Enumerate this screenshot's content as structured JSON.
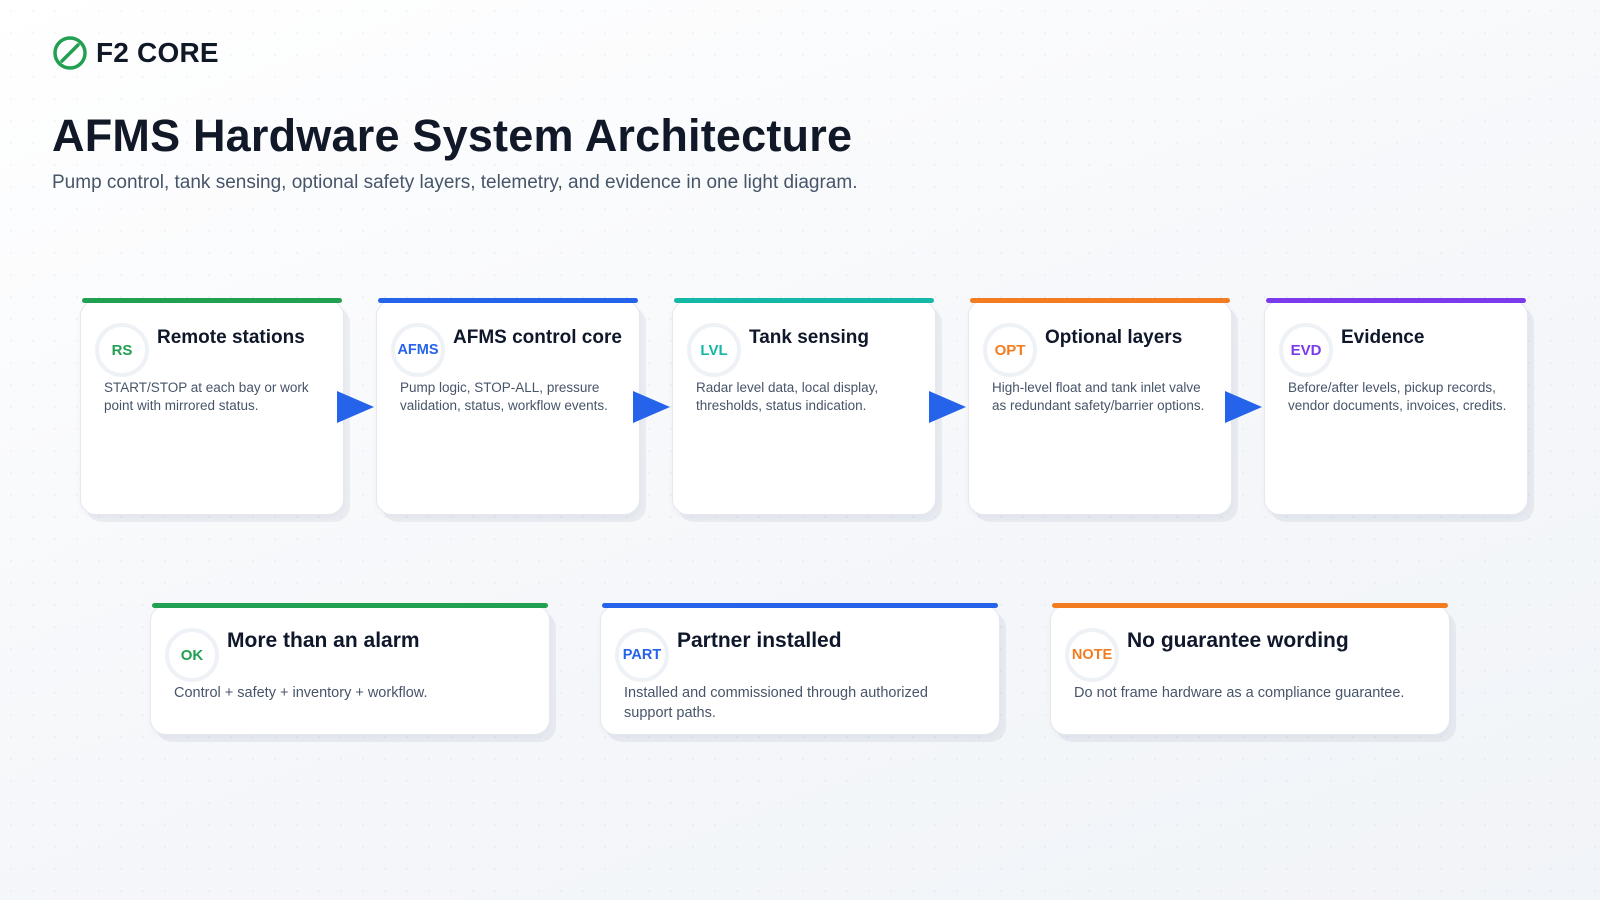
{
  "brand": {
    "name": "F2 CORE",
    "color": "#22a052"
  },
  "page": {
    "title": "AFMS Hardware System Architecture",
    "subtitle": "Pump control, tank sensing, optional safety layers, telemetry, and evidence in one light diagram."
  },
  "flow": [
    {
      "badge": "RS",
      "title": "Remote stations",
      "description": "START/STOP at each bay or work point with mirrored status.",
      "color": "#22a052"
    },
    {
      "badge": "AFMS",
      "title": "AFMS control core",
      "description": "Pump logic, STOP-ALL, pressure validation, status, workflow events.",
      "color": "#2563eb"
    },
    {
      "badge": "LVL",
      "title": "Tank sensing",
      "description": "Radar level data, local display, thresholds, status indication.",
      "color": "#14b8a6"
    },
    {
      "badge": "OPT",
      "title": "Optional layers",
      "description": "High-level float and tank inlet valve as redundant safety/barrier options.",
      "color": "#f47c20"
    },
    {
      "badge": "EVD",
      "title": "Evidence",
      "description": "Before/after levels, pickup records, vendor documents, invoices, credits.",
      "color": "#7c3aed"
    }
  ],
  "arrow_color": "#2563eb",
  "info": [
    {
      "badge": "OK",
      "title": "More than an alarm",
      "description": "Control + safety + inventory + workflow.",
      "color": "#22a052"
    },
    {
      "badge": "PART",
      "title": "Partner installed",
      "description": "Installed and commissioned through authorized support paths.",
      "color": "#2563eb"
    },
    {
      "badge": "NOTE",
      "title": "No guarantee wording",
      "description": "Do not frame hardware as a compliance guarantee.",
      "color": "#f47c20"
    }
  ]
}
